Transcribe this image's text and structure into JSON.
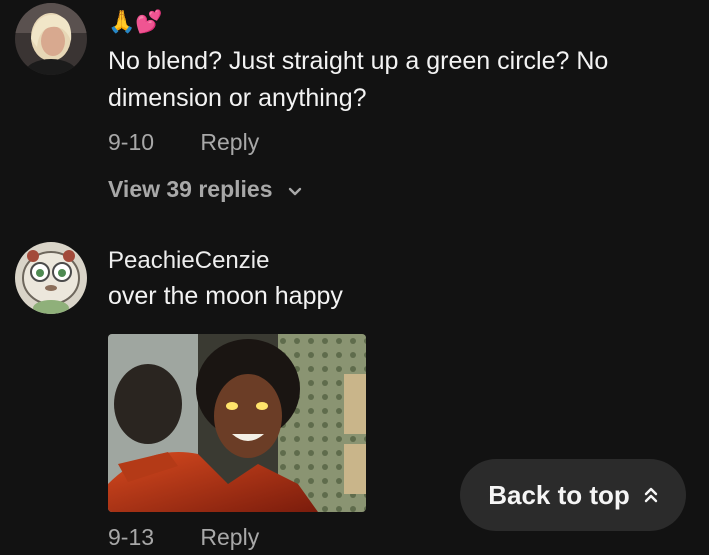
{
  "comments": [
    {
      "emoji": "🙏💕",
      "text": "No blend? Just straight up a green circle? No dimension or anything?",
      "date": "9-10",
      "reply_label": "Reply",
      "view_replies": "View 39 replies"
    },
    {
      "username": "PeachieCenzie",
      "text": "over the moon happy",
      "date": "9-13",
      "reply_label": "Reply"
    }
  ],
  "back_to_top": "Back to top",
  "colors": {
    "background": "#121212",
    "muted": "#a8a8a8",
    "pill": "#2b2b2b"
  },
  "icons": [
    "chevron-down-icon",
    "double-chevron-up-icon"
  ]
}
